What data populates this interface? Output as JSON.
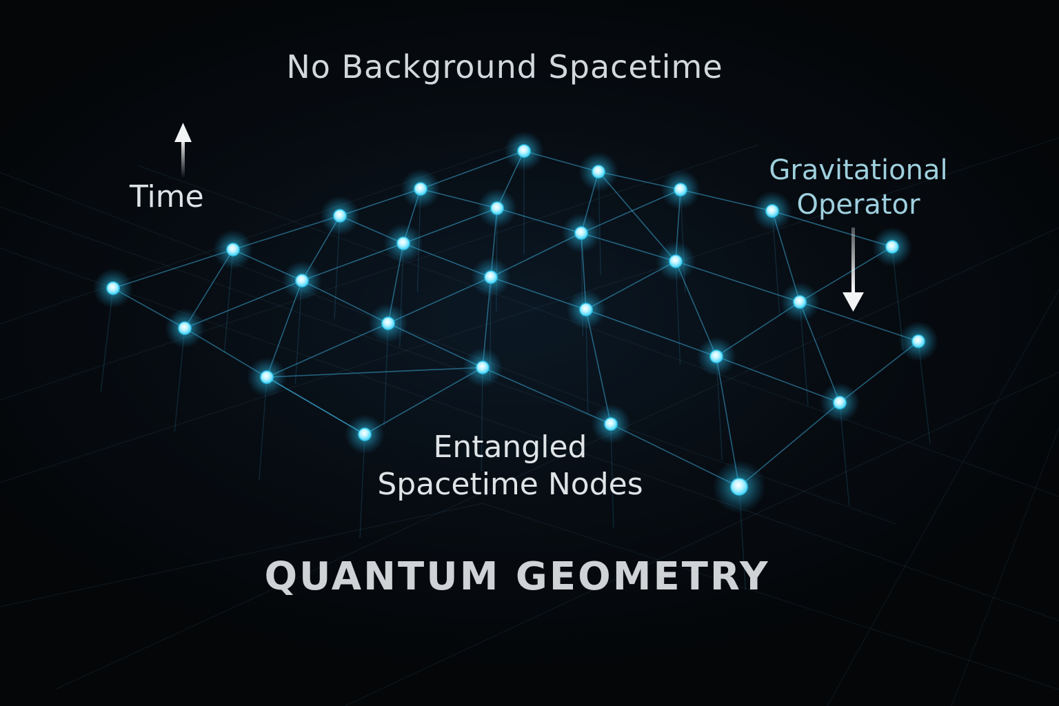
{
  "labels": {
    "top_title": "No Background Spacetime",
    "time": "Time",
    "gravitational_operator_line1": "Gravitational",
    "gravitational_operator_line2": "Operator",
    "nodes_line1": "Entangled",
    "nodes_line2": "Spacetime Nodes",
    "footer_title": "QUANTUM GEOMETRY"
  },
  "icons": {
    "time_arrow": "arrow-up-icon",
    "operator_arrow": "arrow-down-icon"
  },
  "colors": {
    "background": "#05080c",
    "node_core": "#bff4ff",
    "node_glow": "#2fc6ee",
    "edge": "#3aa6d2",
    "text": "#dde3e6",
    "operator_text": "#9fd0de"
  }
}
